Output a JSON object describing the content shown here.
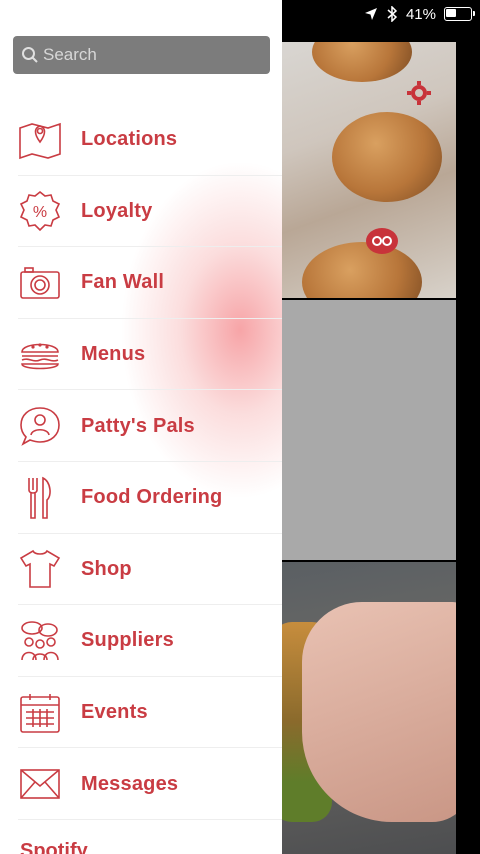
{
  "status_bar": {
    "battery_percent": "41%",
    "battery_level": 0.41
  },
  "search": {
    "placeholder": "Search"
  },
  "menu": {
    "items": [
      {
        "label": "Locations",
        "icon": "map-pin-icon"
      },
      {
        "label": "Loyalty",
        "icon": "percent-badge-icon"
      },
      {
        "label": "Fan Wall",
        "icon": "camera-icon"
      },
      {
        "label": "Menus",
        "icon": "burger-icon"
      },
      {
        "label": "Patty's Pals",
        "icon": "chat-person-icon"
      },
      {
        "label": "Food Ordering",
        "icon": "fork-knife-icon"
      },
      {
        "label": "Shop",
        "icon": "tshirt-icon"
      },
      {
        "label": "Suppliers",
        "icon": "group-people-icon"
      },
      {
        "label": "Events",
        "icon": "calendar-icon"
      },
      {
        "label": "Messages",
        "icon": "envelope-icon"
      }
    ],
    "partial_label": "Spotify"
  },
  "colors": {
    "accent": "#c93c43",
    "search_bg": "#7c7c7c"
  }
}
